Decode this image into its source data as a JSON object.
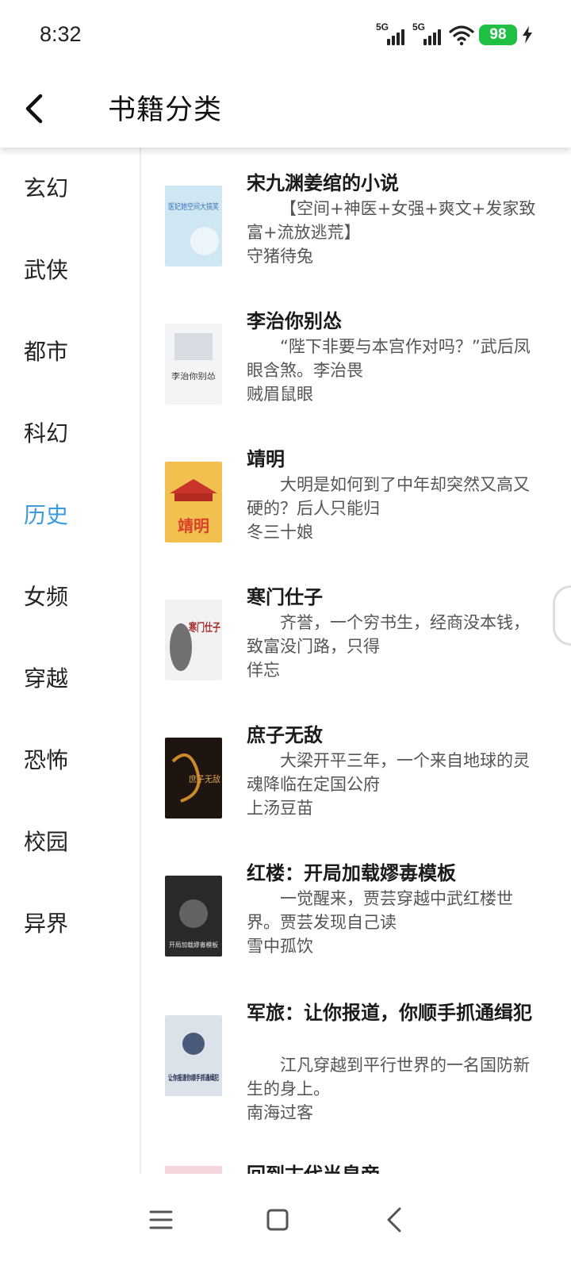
{
  "status_bar": {
    "time": "8:32",
    "signal_1_label": "5G",
    "signal_2_label": "5G",
    "battery_level": "98",
    "icons": [
      "signal-5g-icon",
      "signal-5g-icon",
      "wifi-icon",
      "battery-icon",
      "charging-bolt-icon"
    ]
  },
  "header": {
    "back_icon": "chevron-left-icon",
    "title": "书籍分类"
  },
  "categories": [
    {
      "label": "玄幻",
      "active": false
    },
    {
      "label": "武侠",
      "active": false
    },
    {
      "label": "都市",
      "active": false
    },
    {
      "label": "科幻",
      "active": false
    },
    {
      "label": "历史",
      "active": true
    },
    {
      "label": "女频",
      "active": false
    },
    {
      "label": "穿越",
      "active": false
    },
    {
      "label": "恐怖",
      "active": false
    },
    {
      "label": "校园",
      "active": false
    },
    {
      "label": "异界",
      "active": false
    }
  ],
  "books": [
    {
      "title": "宋九渊姜绾的小说",
      "desc": "【空间+神医+女强+爽文+发家致富+流放逃荒】",
      "author": "守猪待兔"
    },
    {
      "title": "李治你别怂",
      "desc": "“陛下非要与本宫作对吗？”武后凤眼含煞。李治畏",
      "author": "贼眉鼠眼"
    },
    {
      "title": "靖明",
      "desc": "大明是如何到了中年却突然又高又硬的？后人只能归",
      "author": "冬三十娘"
    },
    {
      "title": "寒门仕子",
      "desc": "齐誉，一个穷书生，经商没本钱，致富没门路，只得",
      "author": "佯忘"
    },
    {
      "title": "庶子无敌",
      "desc": "大梁开平三年，一个来自地球的灵魂降临在定国公府",
      "author": "上汤豆苗"
    },
    {
      "title": "红楼：开局加载嫪毐模板",
      "desc": "一觉醒来，贾芸穿越中武红楼世界。贾芸发现自己读",
      "author": "雪中孤饮"
    },
    {
      "title": "军旅：让你报道，你顺手抓通缉犯",
      "desc": "江凡穿越到平行世界的一名国防新生的身上。",
      "author": "南海过客"
    },
    {
      "title": "回到古代当皇帝",
      "desc": "",
      "author": ""
    }
  ],
  "covers": [
    {
      "text": "医妃她空间大搞笑",
      "bg": "#cfe6f3",
      "fg": "#3d78b8"
    },
    {
      "text": "李治你别怂",
      "bg": "#f3f4f6",
      "fg": "#333333"
    },
    {
      "text": "靖明",
      "bg": "#f2c04e",
      "fg": "#d9412b"
    },
    {
      "text": "寒门仕子",
      "bg": "#f2f2f2",
      "fg": "#a22a2a"
    },
    {
      "text": "庶子无敌",
      "bg": "#1e1510",
      "fg": "#d9a24a"
    },
    {
      "text": "开局加载嫪毐模板",
      "bg": "#2a2a2a",
      "fg": "#e6e6e6"
    },
    {
      "text": "让你报道你顺手抓通缉犯",
      "bg": "#dbe2ea",
      "fg": "#1d2b4a"
    },
    {
      "text": "",
      "bg": "#f5d6dd",
      "fg": "#ffffff"
    }
  ],
  "nav_bar": {
    "icons": [
      "menu-icon",
      "home-square-icon",
      "back-icon"
    ]
  },
  "colors": {
    "accent": "#3a9be0",
    "battery": "#1ec043"
  }
}
